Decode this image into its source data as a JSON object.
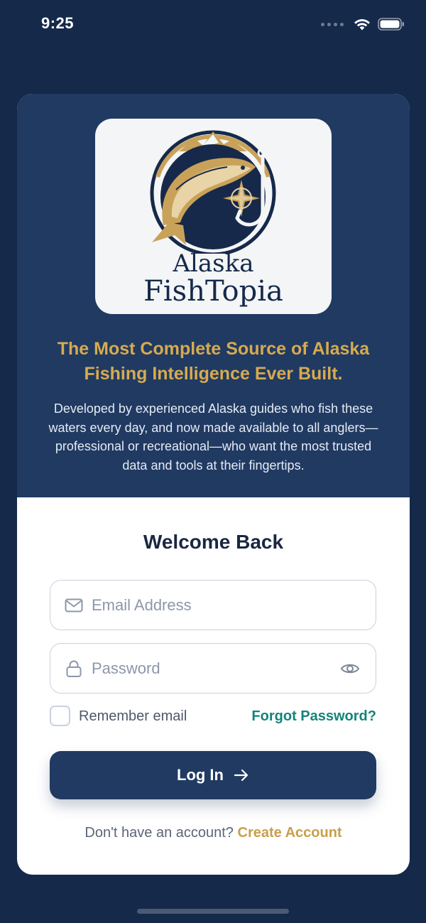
{
  "status_bar": {
    "time": "9:25",
    "icons": [
      "signal-dots-icon",
      "wifi-icon",
      "battery-icon"
    ]
  },
  "logo": {
    "line1": "Alaska",
    "line2": "FishTopia"
  },
  "hero": {
    "tagline": "The Most Complete Source of Alaska Fishing Intelligence Ever Built.",
    "description": "Developed by experienced Alaska guides who fish these waters every day, and now made available to all anglers—professional or recreational—who want the most trusted data and tools at their fingertips."
  },
  "login": {
    "title": "Welcome Back",
    "email_placeholder": "Email Address",
    "password_placeholder": "Password",
    "remember_label": "Remember email",
    "forgot_label": "Forgot Password?",
    "submit_label": "Log In",
    "signup_prompt": "Don't have an account?",
    "signup_link": "Create Account"
  },
  "colors": {
    "background": "#15294a",
    "hero": "#203a62",
    "accent_gold": "#d7aa50",
    "accent_teal": "#14837a",
    "button": "#203a62"
  }
}
